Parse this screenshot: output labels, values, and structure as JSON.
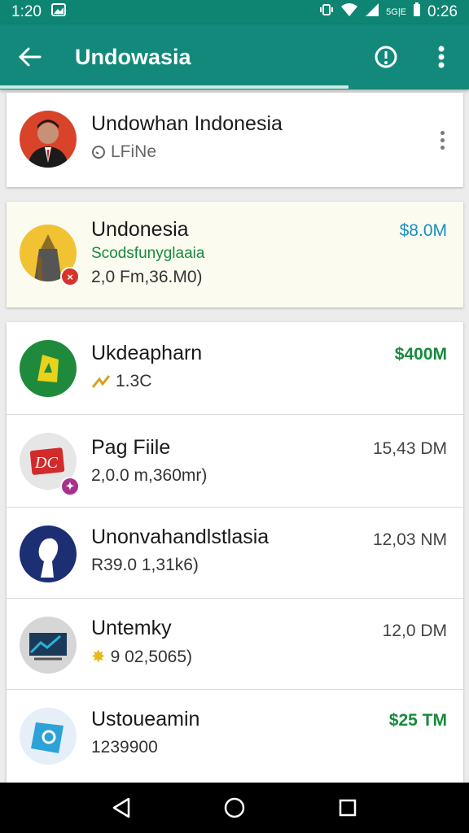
{
  "status_bar": {
    "time": "1:20",
    "network_small": "5G|E",
    "right_time": "0:26"
  },
  "app_bar": {
    "title": "Undowasia"
  },
  "header_card": {
    "name": "Undowhan Indonesia",
    "subtitle": "LFiNe"
  },
  "highlight_card": {
    "name": "Undonesia",
    "amount": "$8.0M",
    "subtitle_green": "Scodsfunyglaaia",
    "subtitle": "2,0 Fm,36.M0)"
  },
  "list": [
    {
      "name": "Ukdeapharn",
      "amount": "$400M",
      "amount_style": "green",
      "sub": "1.3C",
      "sub_icon": "arrow-icon",
      "avatar_color": "#1f8a3b",
      "icon_char": "⚑"
    },
    {
      "name": "Pag Fiile",
      "amount": "15,43 DM",
      "amount_style": "gray",
      "sub": "2,0.0 m,360mr)",
      "avatar_color": "#e6e6e6",
      "icon_char": "DC"
    },
    {
      "name": "Unonvahandlstlasia",
      "amount": "12,03 NM",
      "amount_style": "gray",
      "sub": "R39.0 1,31k6)",
      "avatar_color": "#1d2f73",
      "icon_char": ""
    },
    {
      "name": "Untemky",
      "amount": "12,0 DM",
      "amount_style": "gray",
      "sub": "9 02,5065)",
      "sub_icon": "star-icon",
      "avatar_color": "#d6d6d6",
      "icon_char": ""
    },
    {
      "name": "Ustoueamin",
      "amount": "$25 TM",
      "amount_style": "green",
      "sub": "1239900",
      "avatar_color": "#e6eef7",
      "icon_char": ""
    }
  ],
  "colors": {
    "teal": "#12897a",
    "green": "#178a3d",
    "blue": "#1a8ec2"
  }
}
